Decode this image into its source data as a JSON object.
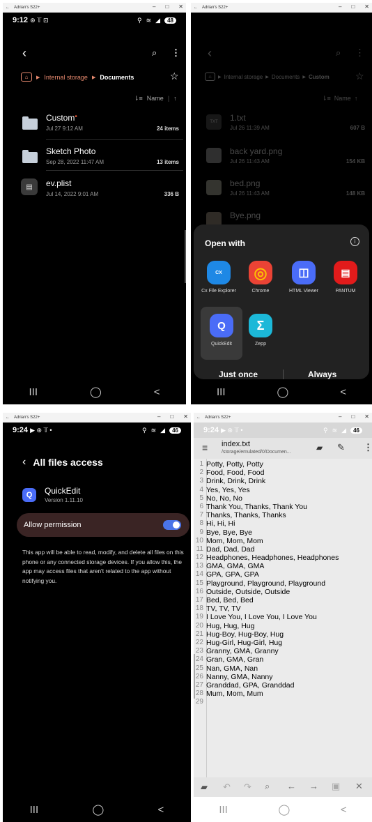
{
  "device_title": "Adrian's S22+",
  "window_controls": [
    "–",
    "□",
    "✕"
  ],
  "nav": [
    "III",
    "◯",
    "<"
  ],
  "panel1": {
    "time": "9:12",
    "status_icons": "⊛ 𝕋 ⊡",
    "battery": "48",
    "breadcrumb": {
      "root": "Internal storage",
      "current": "Documents"
    },
    "sort_label": "Name",
    "files": [
      {
        "name": "Custom",
        "date": "Jul 27 9:12 AM",
        "count": "24 items",
        "type": "folder",
        "dot": true
      },
      {
        "name": "Sketch Photo",
        "date": "Sep 28, 2022 11:47 AM",
        "count": "13 items",
        "type": "folder",
        "dot": false
      },
      {
        "name": "ev.plist",
        "date": "Jul 14, 2022 9:01 AM",
        "count": "336 B",
        "type": "file",
        "dot": false
      }
    ]
  },
  "panel2": {
    "breadcrumb": {
      "root": "Internal storage",
      "mid": "Documents",
      "current": "Custom"
    },
    "sort_label": "Name",
    "files": [
      {
        "name": "1.txt",
        "date": "Jul 26 11:39 AM",
        "size": "607 B",
        "thumb": "TXT"
      },
      {
        "name": "back yard.png",
        "date": "Jul 26 11:43 AM",
        "size": "154 KB",
        "thumb": ""
      },
      {
        "name": "bed.png",
        "date": "Jul 26 11:43 AM",
        "size": "148 KB",
        "thumb": ""
      },
      {
        "name": "Bye.png",
        "date": "",
        "size": "",
        "thumb": ""
      }
    ],
    "open_with": {
      "title": "Open with",
      "apps": [
        {
          "label": "Cx File Explorer",
          "color": "#1e88e5",
          "glyph": "CX"
        },
        {
          "label": "Chrome",
          "color": "#ffffff",
          "glyph": "◎"
        },
        {
          "label": "HTML Viewer",
          "color": "#4a6cf7",
          "glyph": "◫"
        },
        {
          "label": "PANTUM",
          "color": "#e21b1b",
          "glyph": "▤"
        },
        {
          "label": "QuickEdit",
          "color": "#4a6cf7",
          "glyph": "Q"
        },
        {
          "label": "Zepp",
          "color": "#1cb8d8",
          "glyph": "Σ"
        }
      ],
      "just_once": "Just once",
      "always": "Always"
    }
  },
  "panel3": {
    "time": "9:24",
    "status_icons": "▶ ⊛ 𝕋 •",
    "battery": "46",
    "title": "All files access",
    "app_name": "QuickEdit",
    "app_version": "Version 1.11.10",
    "permission_label": "Allow permission",
    "description": "This app will be able to read, modify, and delete all files on this phone or any connected storage devices. If you allow this, the app may access files that aren't related to the app without notifying you."
  },
  "panel4": {
    "time": "9:24",
    "status_icons": "▶ ⊛ 𝕋 •",
    "battery": "46",
    "file_name": "index.txt",
    "file_path": "/storage/emulated/0/Documen...",
    "lines": [
      "Potty, Potty, Potty",
      "Food, Food, Food",
      "Drink, Drink, Drink",
      "Yes, Yes, Yes",
      "No, No, No",
      "Thank You, Thanks, Thank You",
      "Thanks, Thanks, Thanks",
      "Hi, Hi, Hi",
      "Bye, Bye, Bye",
      "Mom, Mom, Mom",
      "Dad, Dad, Dad",
      "Headphones, Headphones, Headphones",
      "GMA, GMA, GMA",
      "GPA, GPA, GPA",
      "Playground, Playground, Playground",
      "Outside, Outside, Outside",
      "Bed, Bed, Bed",
      "TV, TV, TV",
      "I Love You, I Love You, I Love You",
      "Hug, Hug, Hug",
      "Hug-Boy, Hug-Boy, Hug",
      "Hug-Girl, Hug-Girl, Hug",
      "Granny, GMA, Granny",
      "Gran, GMA, Gran",
      "Nan, GMA, Nan",
      "Nanny, GMA, Nanny",
      "Granddad, GPA, Granddad",
      "Mum, Mom, Mum",
      ""
    ]
  }
}
